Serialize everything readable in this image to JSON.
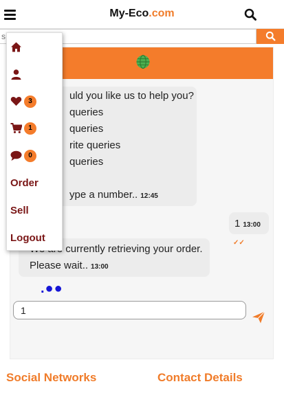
{
  "header": {
    "brand_name": "My-Eco",
    "brand_tld": ".com",
    "menu_icon": "hamburger-icon",
    "search_icon": "search-icon"
  },
  "search": {
    "placeholder": "s",
    "button_icon": "search-icon"
  },
  "chat": {
    "header_icon": "globe-icon",
    "messages": [
      {
        "sender": "bot",
        "lines": [
          "uld you like us to help you?",
          "queries",
          "queries",
          "rite queries",
          "queries",
          "",
          "ype a number.."
        ],
        "time": "12:45"
      },
      {
        "sender": "user",
        "text": "1",
        "time": "13:00",
        "status_icon": "double-check-icon"
      },
      {
        "sender": "bot",
        "lines": [
          "We are currently retrieving your order.",
          "Please wait.."
        ],
        "time": "13:00"
      }
    ],
    "typing_indicator": ".●●",
    "input_value": "1",
    "send_icon": "send-icon"
  },
  "menu": {
    "items": [
      {
        "icon": "home-icon"
      },
      {
        "icon": "user-icon"
      },
      {
        "icon": "heart-icon",
        "badge": "3"
      },
      {
        "icon": "cart-icon",
        "badge": "1"
      },
      {
        "icon": "comment-icon",
        "badge": "0"
      },
      {
        "label": "Order"
      },
      {
        "label": "Sell"
      },
      {
        "label": "Logout"
      }
    ]
  },
  "footer": {
    "social": "Social Networks",
    "contact": "Contact Details"
  },
  "colors": {
    "accent": "#f47c2b",
    "menu_text": "#7a1616",
    "globe": "#4caf50",
    "typing_dots": "#1616d6"
  }
}
